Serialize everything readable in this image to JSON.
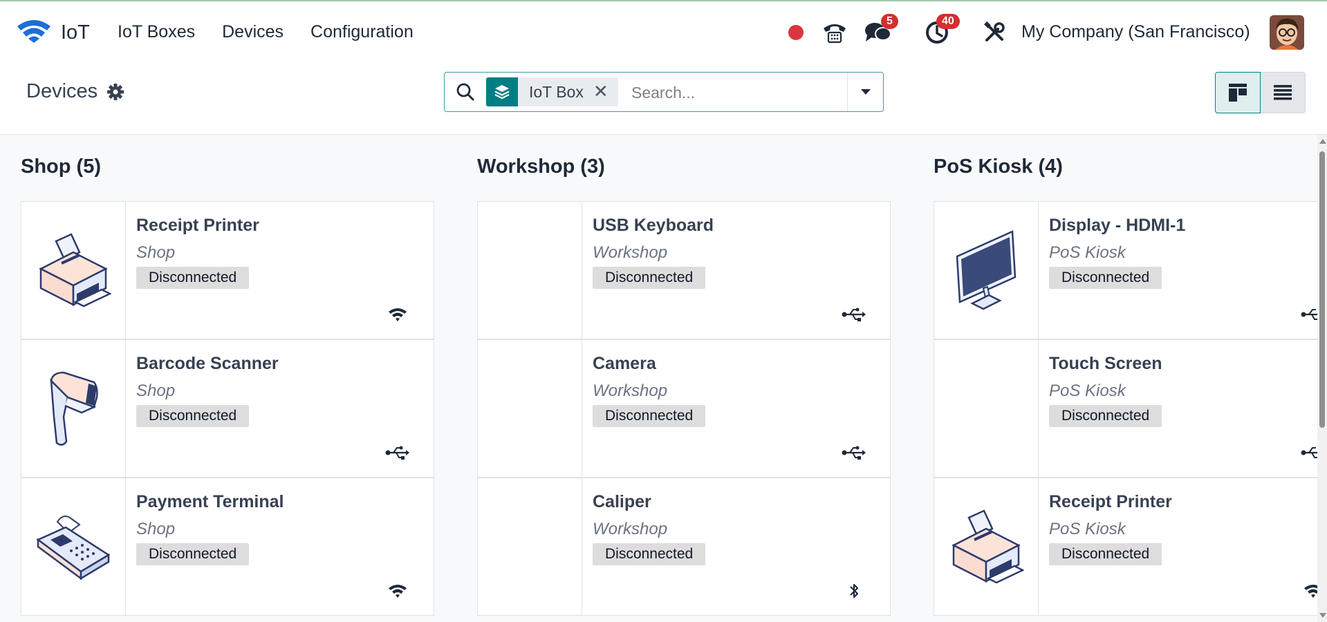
{
  "app": {
    "name": "IoT",
    "icon": "wifi-logo-icon",
    "accent": "#017e84"
  },
  "menu": [
    {
      "label": "IoT Boxes"
    },
    {
      "label": "Devices"
    },
    {
      "label": "Configuration"
    }
  ],
  "systray": {
    "activities_badge": "40",
    "messages_badge": "5",
    "company": "My Company (San Francisco)",
    "status_color": "#d32f2f"
  },
  "control_panel": {
    "title": "Devices",
    "facet_label": "IoT Box",
    "search_placeholder": "Search..."
  },
  "columns": [
    {
      "title": "Shop (5)",
      "cards": [
        {
          "name": "Receipt Printer",
          "box": "Shop",
          "status": "Disconnected",
          "image": "printer-image",
          "connection": "wifi-icon"
        },
        {
          "name": "Barcode Scanner",
          "box": "Shop",
          "status": "Disconnected",
          "image": "barcode-scanner-image",
          "connection": "usb-icon"
        },
        {
          "name": "Payment Terminal",
          "box": "Shop",
          "status": "Disconnected",
          "image": "payment-terminal-image",
          "connection": "wifi-icon"
        }
      ]
    },
    {
      "title": "Workshop (3)",
      "cards": [
        {
          "name": "USB Keyboard",
          "box": "Workshop",
          "status": "Disconnected",
          "image": "",
          "connection": "usb-icon"
        },
        {
          "name": "Camera",
          "box": "Workshop",
          "status": "Disconnected",
          "image": "",
          "connection": "usb-icon"
        },
        {
          "name": "Caliper",
          "box": "Workshop",
          "status": "Disconnected",
          "image": "",
          "connection": "bluetooth-icon"
        }
      ]
    },
    {
      "title": "PoS Kiosk (4)",
      "cards": [
        {
          "name": "Display - HDMI-1",
          "box": "PoS Kiosk",
          "status": "Disconnected",
          "image": "monitor-image",
          "connection": "usb-icon"
        },
        {
          "name": "Touch Screen",
          "box": "PoS Kiosk",
          "status": "Disconnected",
          "image": "",
          "connection": "usb-icon"
        },
        {
          "name": "Receipt Printer",
          "box": "PoS Kiosk",
          "status": "Disconnected",
          "image": "printer-image",
          "connection": "wifi-icon"
        }
      ]
    }
  ]
}
